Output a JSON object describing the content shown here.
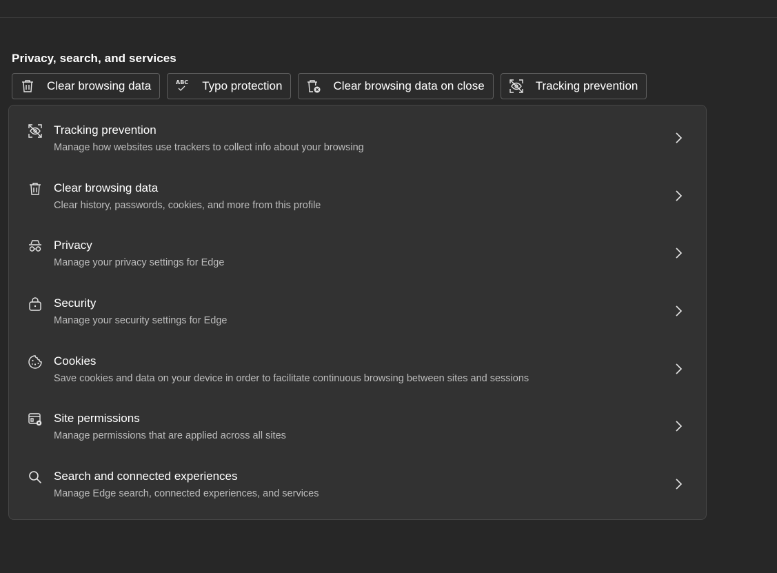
{
  "section": {
    "title": "Privacy, search, and services"
  },
  "chips": [
    {
      "label": "Clear browsing data",
      "icon": "trash-icon"
    },
    {
      "label": "Typo protection",
      "icon": "abc-check-icon"
    },
    {
      "label": "Clear browsing data on close",
      "icon": "trash-x-icon"
    },
    {
      "label": "Tracking prevention",
      "icon": "tracking-prevention-icon"
    }
  ],
  "items": [
    {
      "title": "Tracking prevention",
      "description": "Manage how websites use trackers to collect info about your browsing",
      "icon": "tracking-prevention-icon"
    },
    {
      "title": "Clear browsing data",
      "description": "Clear history, passwords, cookies, and more from this profile",
      "icon": "trash-icon"
    },
    {
      "title": "Privacy",
      "description": "Manage your privacy settings for Edge",
      "icon": "incognito-icon"
    },
    {
      "title": "Security",
      "description": "Manage your security settings for Edge",
      "icon": "lock-icon"
    },
    {
      "title": "Cookies",
      "description": "Save cookies and data on your device in order to facilitate continuous browsing between sites and sessions",
      "icon": "cookie-icon"
    },
    {
      "title": "Site permissions",
      "description": "Manage permissions that are applied across all sites",
      "icon": "site-permissions-icon"
    },
    {
      "title": "Search and connected experiences",
      "description": "Manage Edge search, connected experiences, and services",
      "icon": "search-icon"
    }
  ],
  "colors": {
    "background": "#272727",
    "card": "#323232",
    "border": "#464646",
    "text": "#ffffff",
    "secondary_text": "#bdbdbd"
  }
}
